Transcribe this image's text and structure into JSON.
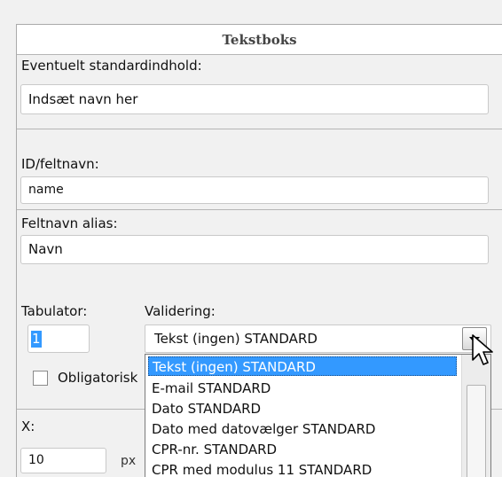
{
  "panel": {
    "title": "Tekstboks"
  },
  "default_content": {
    "label": "Eventuelt standardindhold:",
    "value": "Indsæt navn her"
  },
  "field_id": {
    "label": "ID/feltnavn:",
    "value": "name"
  },
  "field_alias": {
    "label": "Feltnavn alias:",
    "value": "Navn"
  },
  "tabulator": {
    "label": "Tabulator:",
    "value": "1"
  },
  "validation": {
    "label": "Validering:",
    "selected": "Tekst (ingen) STANDARD",
    "options": [
      "Tekst (ingen) STANDARD",
      "E-mail STANDARD",
      "Dato STANDARD",
      "Dato med datovælger STANDARD",
      "CPR-nr. STANDARD",
      "CPR med modulus 11 STANDARD"
    ]
  },
  "required": {
    "label": "Obligatorisk"
  },
  "x_position": {
    "label": "X:",
    "value": "10",
    "unit": "px"
  },
  "icons": {
    "dropdown": "chevron-down-icon",
    "cursor": "mouse-pointer-icon"
  }
}
